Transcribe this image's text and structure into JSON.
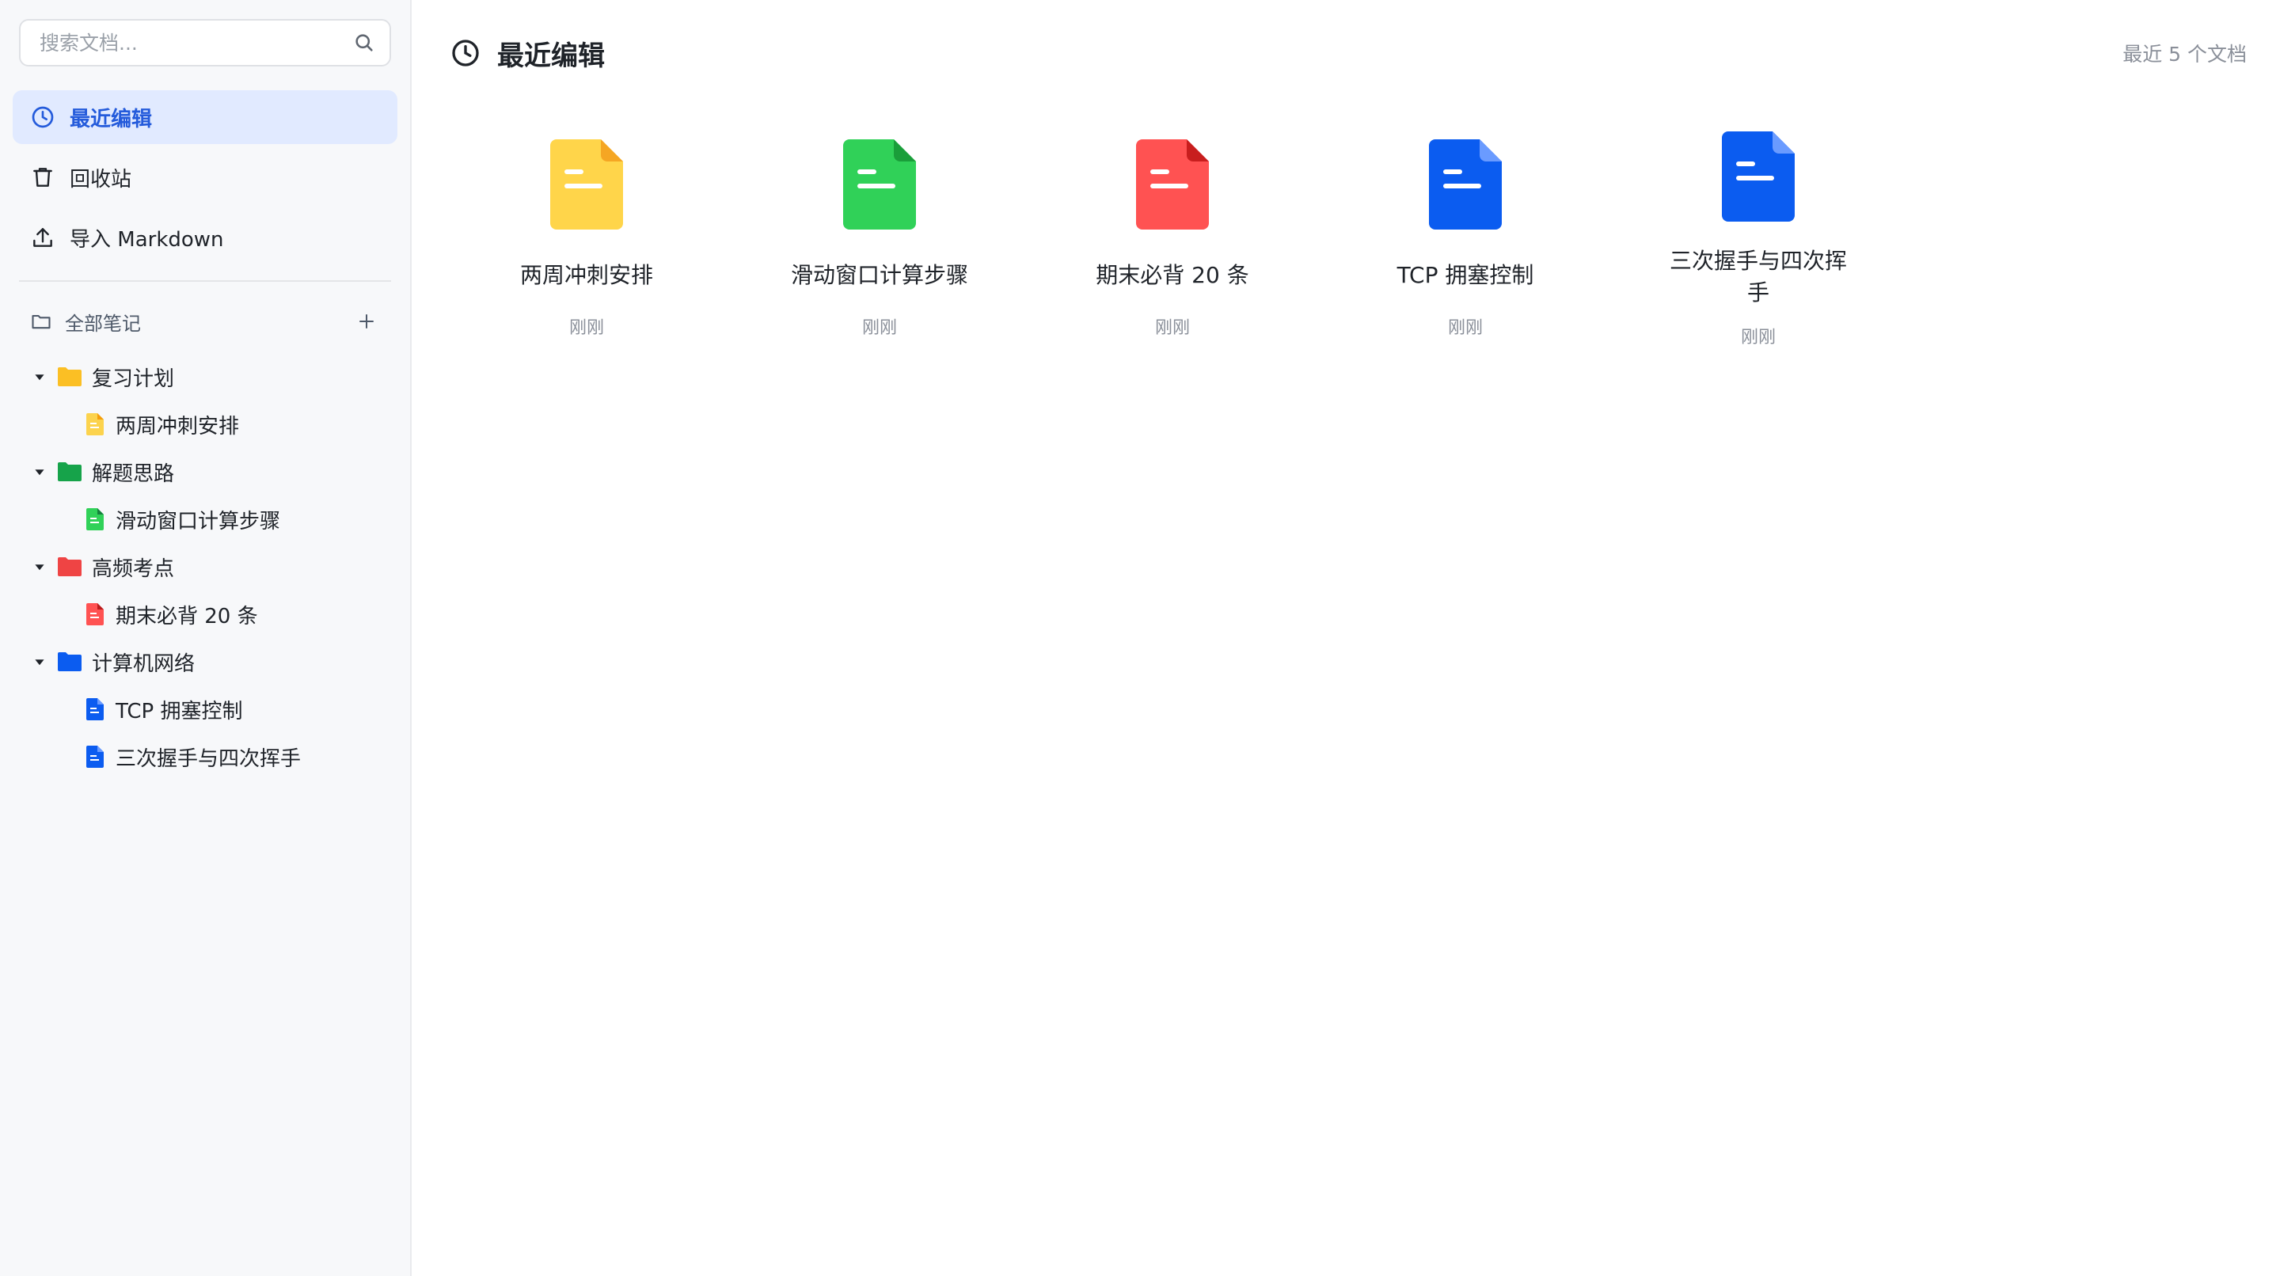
{
  "search": {
    "placeholder": "搜索文档..."
  },
  "nav": [
    {
      "label": "最近编辑",
      "icon": "clock-icon",
      "active": true
    },
    {
      "label": "回收站",
      "icon": "trash-icon",
      "active": false
    },
    {
      "label": "导入 Markdown",
      "icon": "upload-icon",
      "active": false
    }
  ],
  "notes": {
    "header": "全部笔记",
    "folders": [
      {
        "name": "复习计划",
        "color": "#fbbf24",
        "docs": [
          "两周冲刺安排"
        ]
      },
      {
        "name": "解题思路",
        "color": "#16a34a",
        "docs": [
          "滑动窗口计算步骤"
        ]
      },
      {
        "name": "高频考点",
        "color": "#ef4444",
        "docs": [
          "期末必背 20 条"
        ]
      },
      {
        "name": "计算机网络",
        "color": "#0b5cf0",
        "docs": [
          "TCP 拥塞控制",
          "三次握手与四次挥手"
        ]
      }
    ]
  },
  "main": {
    "title": "最近编辑",
    "count": "最近 5 个文档",
    "cards": [
      {
        "title": "两周冲刺安排",
        "time": "刚刚",
        "color": "#ffd54a",
        "fold": "#f5a623"
      },
      {
        "title": "滑动窗口计算步骤",
        "time": "刚刚",
        "color": "#30d158",
        "fold": "#1a9e3a"
      },
      {
        "title": "期末必背 20 条",
        "time": "刚刚",
        "color": "#ff5252",
        "fold": "#c81e1e"
      },
      {
        "title": "TCP 拥塞控制",
        "time": "刚刚",
        "color": "#0b5cf0",
        "fold": "#6a9bff"
      },
      {
        "title": "三次握手与四次挥手",
        "time": "刚刚",
        "color": "#0b5cf0",
        "fold": "#6a9bff"
      }
    ]
  },
  "colors": {
    "accent": "#245bdb",
    "active_bg": "#e1eaff"
  }
}
